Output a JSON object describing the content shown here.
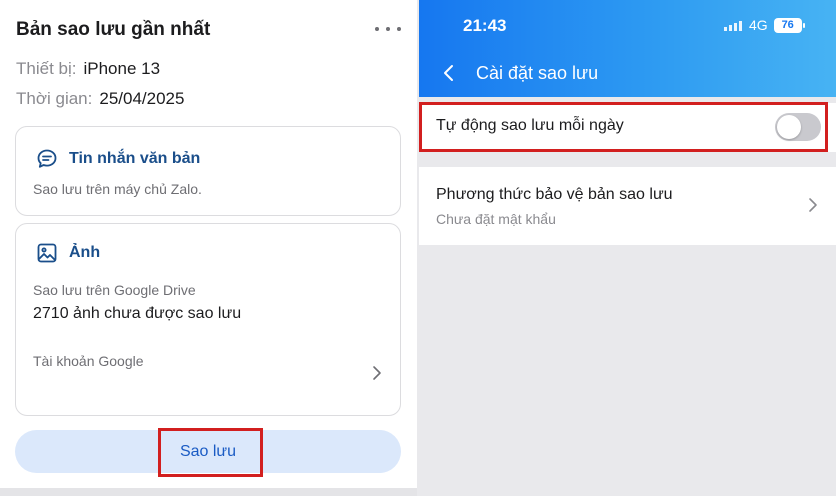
{
  "left": {
    "title": "Bản sao lưu gần nhất",
    "more_icon": "more-horizontal-icon",
    "device": {
      "label": "Thiết bị:",
      "value": "iPhone 13"
    },
    "time": {
      "label": "Thời gian:",
      "value": "25/04/2025"
    },
    "text_card": {
      "icon": "chat-bubble-icon",
      "title": "Tin nhắn văn bản",
      "subtitle": "Sao lưu trên máy chủ Zalo."
    },
    "photo_card": {
      "icon": "image-icon",
      "title": "Ảnh",
      "subtitle": "Sao lưu trên Google Drive",
      "count_text": "2710 ảnh chưa được sao lưu",
      "account_label": "Tài khoản Google"
    },
    "backup_button": "Sao lưu"
  },
  "right": {
    "status_bar": {
      "time": "21:43",
      "network": "4G",
      "battery": "76"
    },
    "header_title": "Cài đặt sao lưu",
    "auto_backup": {
      "label": "Tự động sao lưu mỗi ngày",
      "enabled": false
    },
    "protection": {
      "title": "Phương thức bảo vệ bản sao lưu",
      "subtitle": "Chưa đặt mật khẩu"
    }
  },
  "colors": {
    "accent_blue": "#1a4e8a",
    "button_bg": "#dbe8fb",
    "button_text": "#1a5bc4",
    "header_start": "#1677f0",
    "header_end": "#47b3f3",
    "highlight_red": "#d21f1f"
  }
}
